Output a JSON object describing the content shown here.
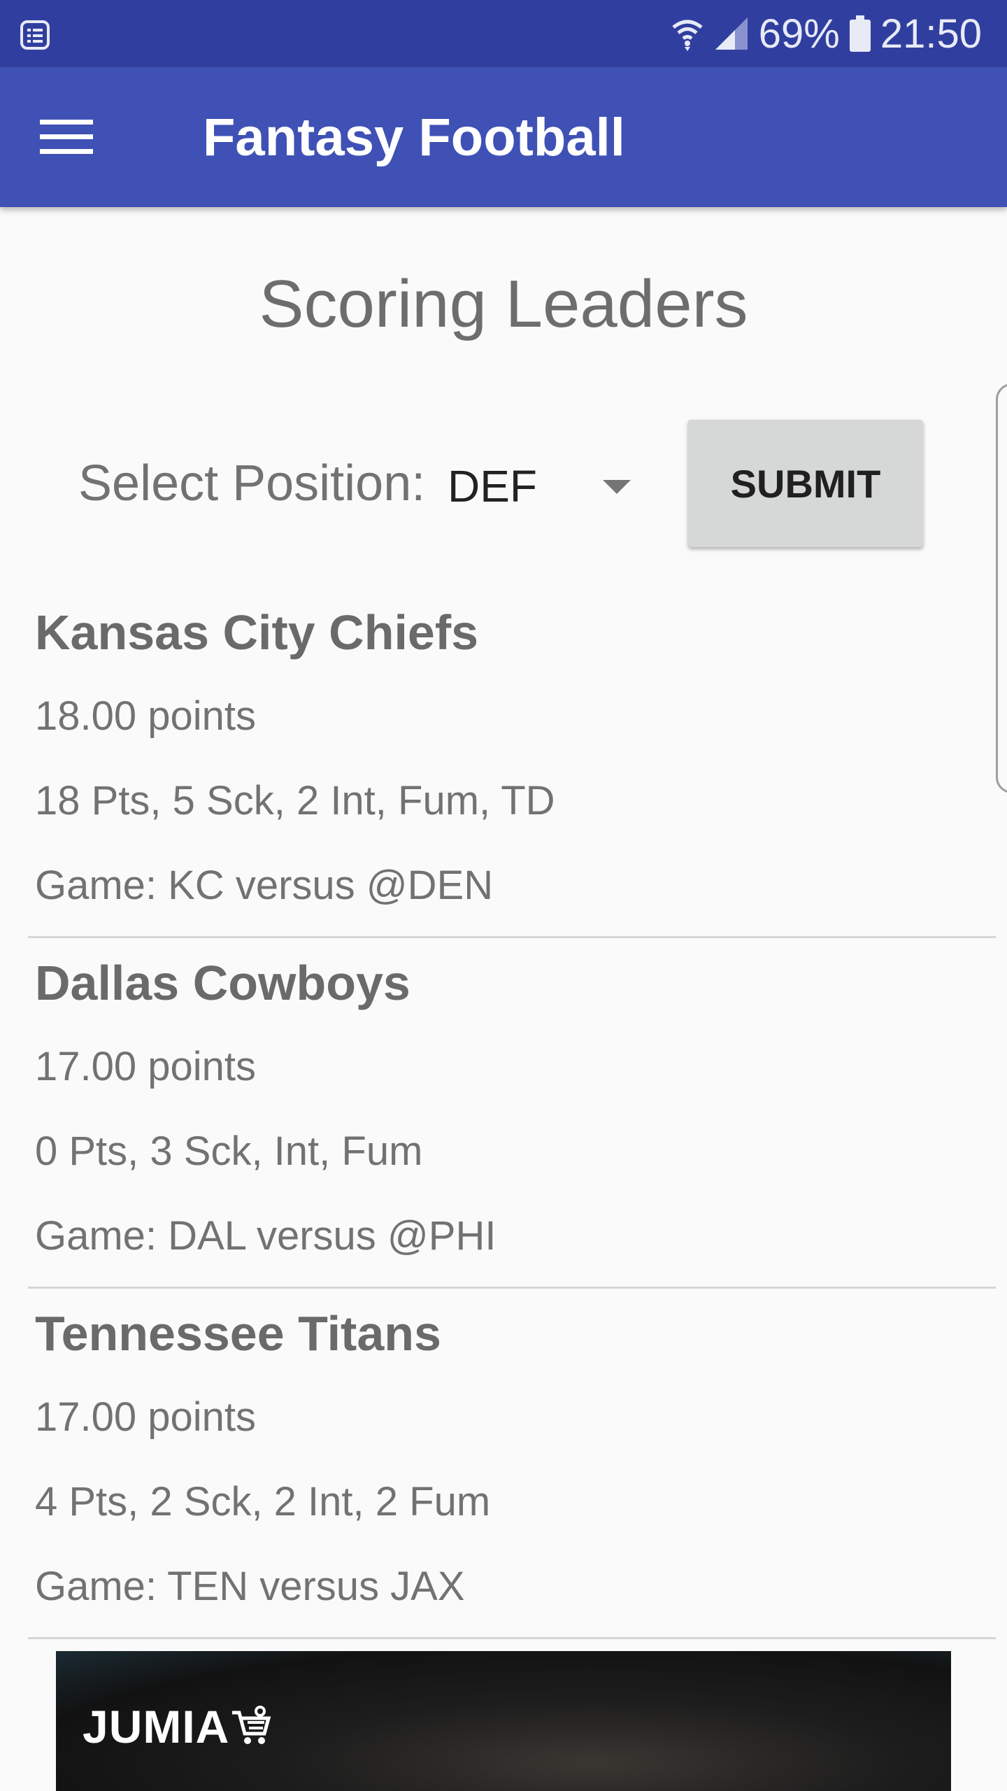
{
  "status_bar": {
    "battery": "69%",
    "time": "21:50",
    "icons": [
      "notification-icon",
      "wifi-icon",
      "signal-icon",
      "battery-icon"
    ]
  },
  "app_bar": {
    "title": "Fantasy Football",
    "menu_icon": "menu-icon"
  },
  "page": {
    "title": "Scoring Leaders",
    "position_label": "Select Position:",
    "position_value": "DEF",
    "submit_label": "SUBMIT"
  },
  "leaders": [
    {
      "team": "Kansas City Chiefs",
      "points": "18.00 points",
      "stats": "18 Pts, 5 Sck, 2 Int, Fum, TD",
      "game": "Game: KC versus @DEN"
    },
    {
      "team": "Dallas Cowboys",
      "points": "17.00 points",
      "stats": "0 Pts, 3 Sck, Int, Fum",
      "game": "Game: DAL versus @PHI"
    },
    {
      "team": "Tennessee Titans",
      "points": "17.00 points",
      "stats": "4 Pts, 2 Sck, 2 Int, 2 Fum",
      "game": "Game: TEN versus JAX"
    }
  ],
  "ad": {
    "brand": "JUMIA"
  },
  "colors": {
    "status_bar": "#303f9f",
    "app_bar": "#3f51b5",
    "background": "#fafafa",
    "button": "#d6d7d7"
  }
}
